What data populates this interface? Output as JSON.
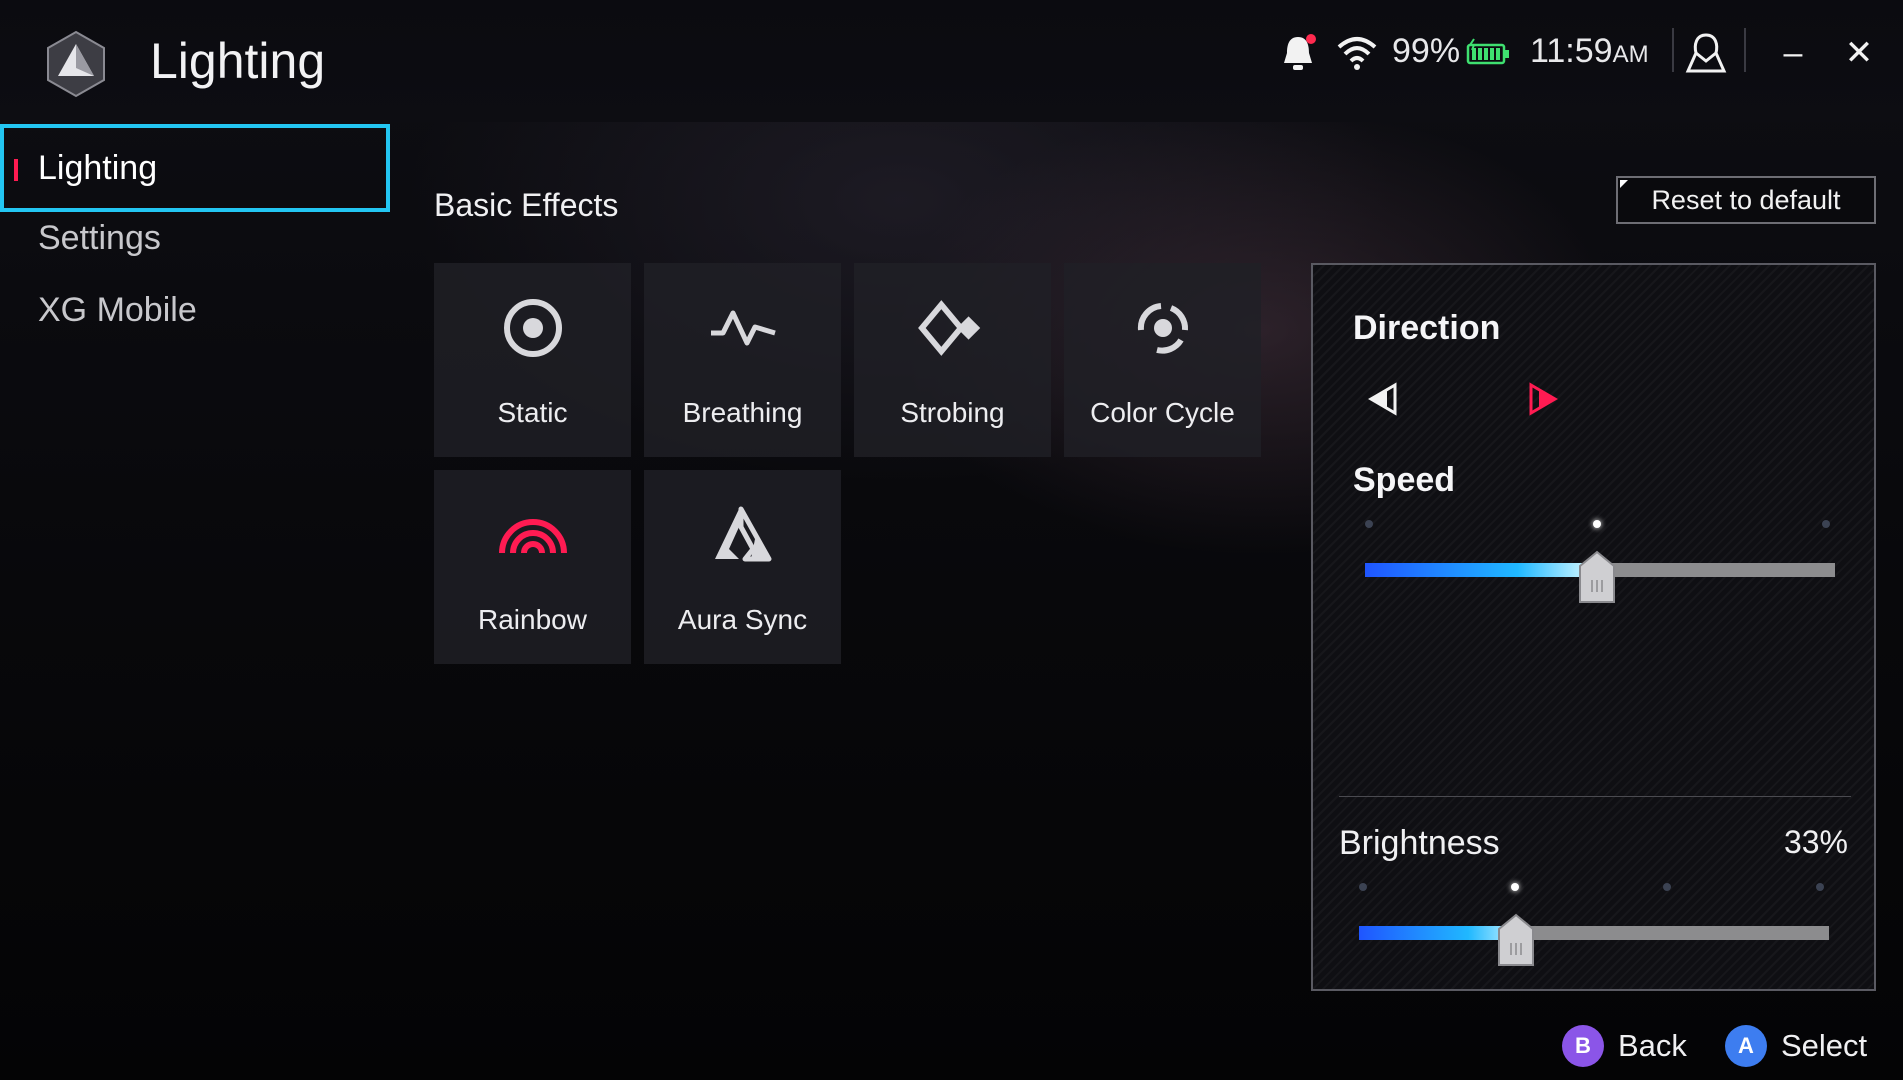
{
  "app": {
    "title": "Lighting"
  },
  "status": {
    "battery": "99%",
    "time": "11:59",
    "ampm": "AM"
  },
  "window": {
    "minimize_label": "–",
    "close_label": "✕"
  },
  "sidebar": {
    "items": [
      {
        "label": "Lighting",
        "active": true
      },
      {
        "label": "Settings",
        "active": false
      },
      {
        "label": "XG Mobile",
        "active": false
      }
    ]
  },
  "main": {
    "section_title": "Basic Effects",
    "reset_label": "Reset to default",
    "effects": [
      {
        "label": "Static",
        "icon": "static-icon"
      },
      {
        "label": "Breathing",
        "icon": "breathing-icon"
      },
      {
        "label": "Strobing",
        "icon": "strobing-icon"
      },
      {
        "label": "Color Cycle",
        "icon": "color-cycle-icon"
      },
      {
        "label": "Rainbow",
        "icon": "rainbow-icon"
      },
      {
        "label": "Aura Sync",
        "icon": "aura-sync-icon"
      }
    ]
  },
  "panel": {
    "direction_label": "Direction",
    "speed_label": "Speed",
    "speed_levels": 3,
    "speed_selected_index": 1,
    "brightness_label": "Brightness",
    "brightness_value": "33%",
    "brightness_levels": 4,
    "brightness_selected_index": 1
  },
  "footer": {
    "back_label": "Back",
    "select_label": "Select"
  },
  "colors": {
    "accent": "#23c6f2",
    "highlight": "#ff1b52",
    "back_button": "#8b55e8",
    "select_button": "#3d7df0"
  }
}
